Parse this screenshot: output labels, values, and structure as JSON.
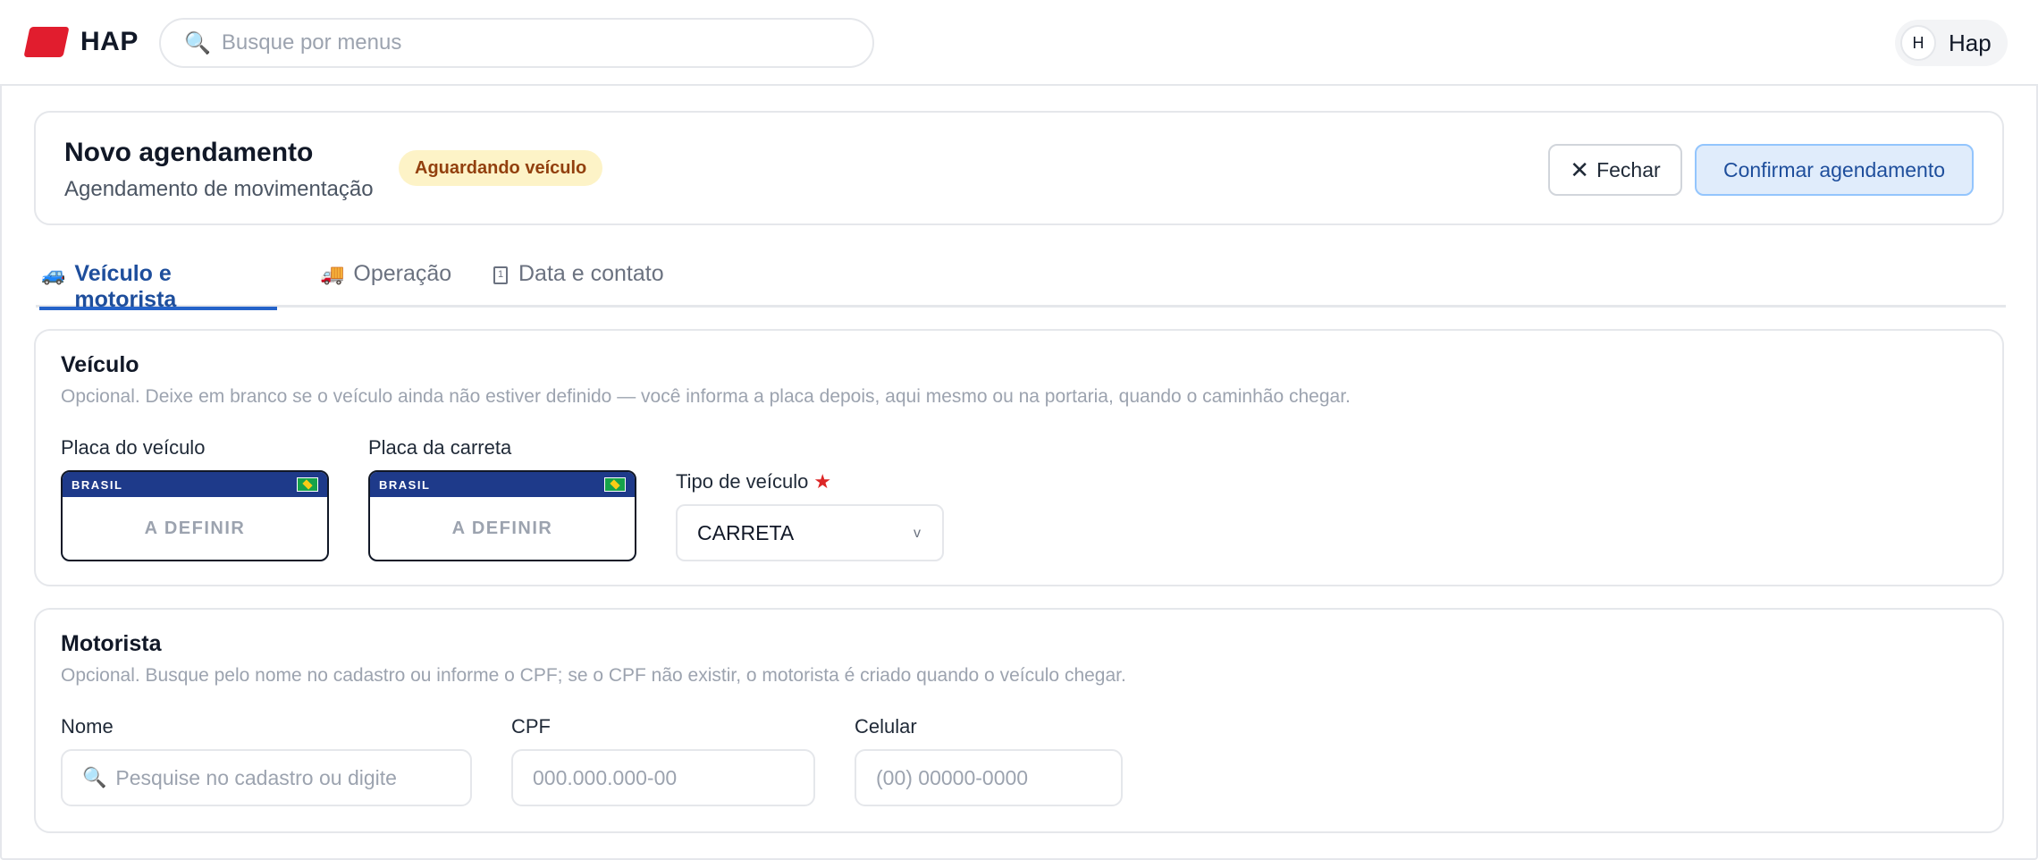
{
  "app": {
    "logo_text": "HAP"
  },
  "search": {
    "placeholder": "Busque por menus",
    "icon": "search-icon"
  },
  "user": {
    "initial": "H",
    "name": "Hap"
  },
  "header": {
    "title": "Novo agendamento",
    "subtitle": "Agendamento de movimentação",
    "status": "Aguardando veículo",
    "close_label": "Fechar",
    "confirm_label": "Confirmar agendamento"
  },
  "tabs": [
    {
      "label": "Veículo e motorista",
      "icon": "🚙",
      "active": true
    },
    {
      "label": "Operação",
      "icon": "🚚",
      "active": false
    },
    {
      "label": "Data e contato",
      "icon": "1",
      "active": false
    }
  ],
  "vehicle": {
    "title": "Veículo",
    "description": "Opcional. Deixe em branco se o veículo ainda não estiver definido — você informa a placa depois, aqui mesmo ou na portaria, quando o caminhão chegar.",
    "plate_label": "Placa do veículo",
    "trailer_label": "Placa da carreta",
    "plate_country": "BRASIL",
    "plate_value": "A DEFINIR",
    "trailer_value": "A DEFINIR",
    "type_label": "Tipo de veículo",
    "type_required": "★",
    "type_value": "CARRETA",
    "type_chevron": "v"
  },
  "driver": {
    "title": "Motorista",
    "description": "Opcional. Busque pelo nome no cadastro ou informe o CPF; se o CPF não existir, o motorista é criado quando o veículo chegar.",
    "name_label": "Nome",
    "name_placeholder": "Pesquise no cadastro ou digite",
    "cpf_label": "CPF",
    "cpf_placeholder": "000.000.000-00",
    "phone_label": "Celular",
    "phone_placeholder": "(00) 00000-0000"
  },
  "colors": {
    "brand_red": "#e11d2e",
    "accent_blue": "#2563c9",
    "badge_bg": "#fdf3c7",
    "plate_band": "#1e3a8a"
  }
}
